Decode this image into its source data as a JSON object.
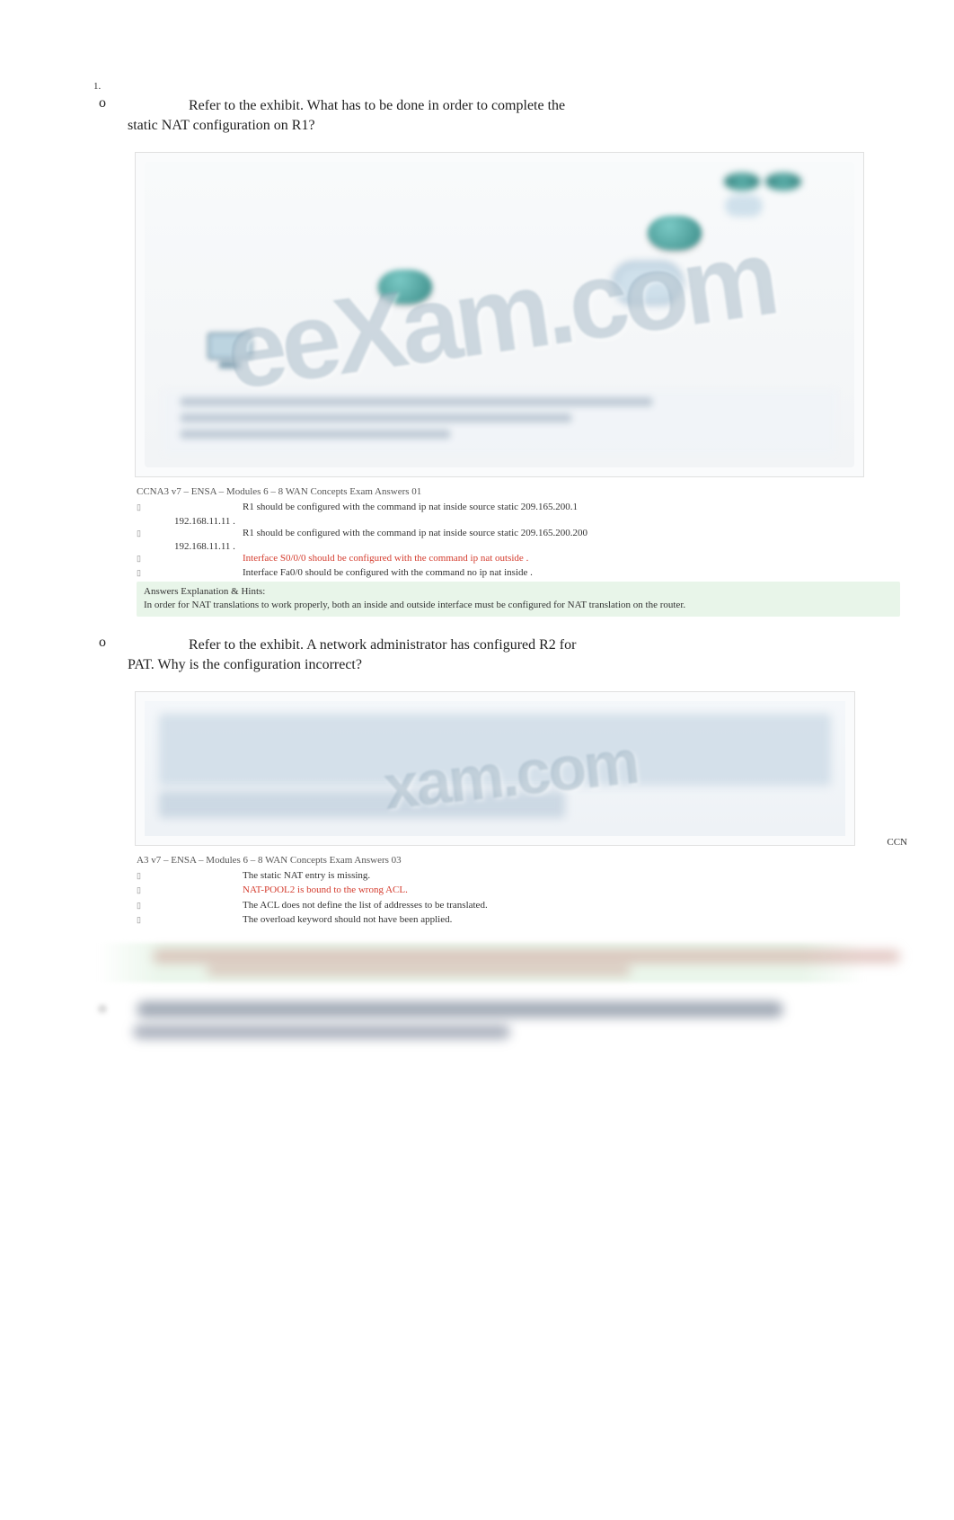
{
  "q1": {
    "number": "1.",
    "marker": "o",
    "stem_line1": "Refer to the exhibit. What has to be done in order to complete the",
    "stem_line2": "static NAT configuration on R1?",
    "watermark": "eeXam.com",
    "caption": "CCNA3 v7 – ENSA – Modules 6 – 8 WAN Concepts Exam Answers 01",
    "options": [
      {
        "text": "R1 should be configured with the command ip nat inside source static 209.165.200.1",
        "wrap": "192.168.11.11 .",
        "red": false
      },
      {
        "text": "R1 should be configured with the command ip nat inside source static 209.165.200.200",
        "wrap": "192.168.11.11 .",
        "red": false
      },
      {
        "text": "Interface S0/0/0 should be configured with the command ip nat outside .",
        "red": true
      },
      {
        "text": "Interface Fa0/0 should be configured with the command no ip nat inside .",
        "red": false
      }
    ],
    "answers_title": "Answers Explanation & Hints:",
    "answers_body": "In order for NAT translations to work properly, both an inside and outside interface must be configured for NAT translation on the router."
  },
  "q2": {
    "marker": "o",
    "stem_line1": "Refer to the exhibit. A network administrator has configured R2 for",
    "stem_line2": "PAT. Why is the configuration incorrect?",
    "watermark": "xam.com",
    "right_tag": "CCN",
    "caption": "A3 v7 – ENSA – Modules 6 – 8 WAN Concepts Exam Answers 03",
    "options": [
      {
        "text": "The static NAT entry is missing.",
        "red": false
      },
      {
        "text": "NAT-POOL2 is bound to the wrong ACL.",
        "red": true
      },
      {
        "text": "The ACL does not define the list of addresses to be translated.",
        "red": false
      },
      {
        "text": "The overload keyword should not have been applied.",
        "red": false
      }
    ]
  }
}
